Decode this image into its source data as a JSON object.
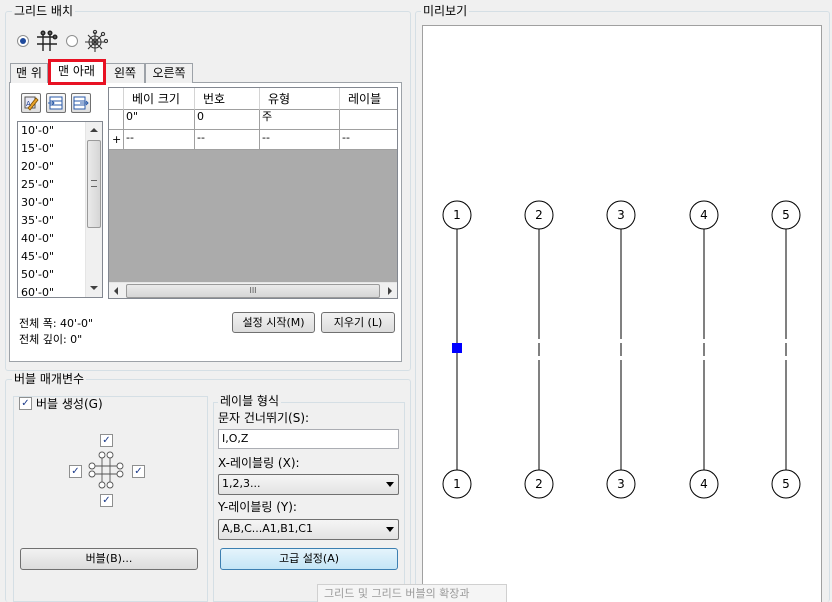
{
  "grid_layout": {
    "title": "그리드 배치",
    "tabs": [
      "맨 위",
      "맨 아래",
      "왼쪽",
      "오른쪽"
    ],
    "list_values": [
      "10'-0\"",
      "15'-0\"",
      "20'-0\"",
      "25'-0\"",
      "30'-0\"",
      "35'-0\"",
      "40'-0\"",
      "45'-0\"",
      "50'-0\"",
      "60'-0\""
    ],
    "columns": [
      "베이 크기",
      "번호",
      "유형",
      "레이블"
    ],
    "rows": [
      {
        "marker": "",
        "cells": [
          "0\"",
          "0",
          "주",
          ""
        ]
      },
      {
        "marker": "+",
        "cells": [
          "--",
          "--",
          "--",
          "--"
        ]
      }
    ],
    "hscroll_grip": "III",
    "start_setup_button": "설정 시작(M)",
    "clear_button": "지우기 (L)",
    "total_width": "전체 폭: 40'-0\"",
    "total_depth": "전체 깊이: 0\""
  },
  "bubble_params": {
    "title": "버블 매개변수",
    "create_bubble_label": "버블 생성(G)",
    "bubble_button": "버블(B)...",
    "label_format": {
      "title": "레이블 형식",
      "skip_chars_label": "문자 건너뛰기(S):",
      "skip_chars_value": "I,O,Z",
      "x_label": "X-레이블링 (X):",
      "x_value": "1,2,3...",
      "y_label": "Y-레이블링 (Y):",
      "y_value": "A,B,C...A1,B1,C1"
    },
    "advanced_button": "고급 설정(A)"
  },
  "preview": {
    "title": "미리보기",
    "bubble_labels": [
      "1",
      "2",
      "3",
      "4",
      "5"
    ]
  },
  "tooltip": "그리드 및 그리드 버블의 확장과",
  "colors": {
    "highlight_box": "#e81123",
    "grip_blue": "#0000ff",
    "accent_button": "#cde8f8"
  }
}
